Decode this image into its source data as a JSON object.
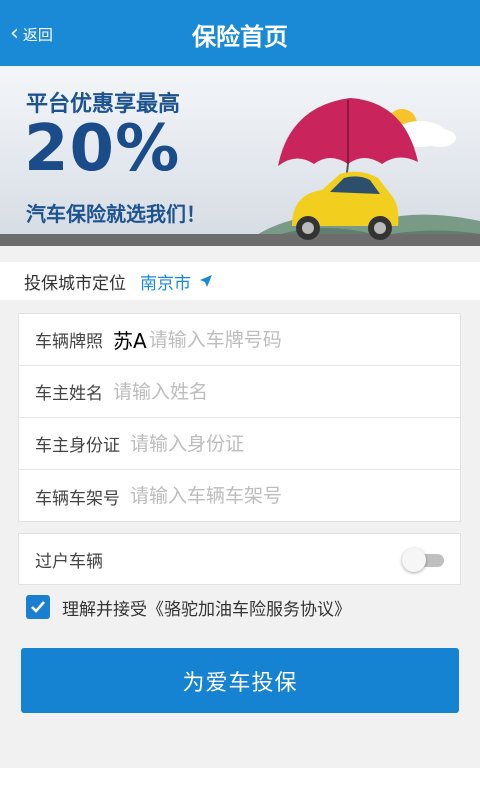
{
  "header": {
    "back_label": "返回",
    "title": "保险首页"
  },
  "banner": {
    "line1": "平台优惠享最高",
    "percent": "20%",
    "line2": "汽车保险就选我们！"
  },
  "city": {
    "label": "投保城市定位",
    "value": "南京市"
  },
  "form": {
    "plate": {
      "label": "车辆牌照",
      "prefix": "苏A",
      "placeholder": "请输入车牌号码"
    },
    "name": {
      "label": "车主姓名",
      "placeholder": "请输入姓名"
    },
    "id_card": {
      "label": "车主身份证",
      "placeholder": "请输入身份证"
    },
    "vin": {
      "label": "辆车架号",
      "label_full": "车辆车架号",
      "placeholder": "请输入车辆车架号"
    }
  },
  "transfer": {
    "label": "过户车辆",
    "enabled": false
  },
  "agreement": {
    "checked": true,
    "text": "理解并接受《骆驼加油车险服务协议》"
  },
  "submit_label": "为爱车投保",
  "colors": {
    "primary": "#1a8ad6",
    "button": "#1582d2",
    "banner_text": "#1c5390"
  }
}
